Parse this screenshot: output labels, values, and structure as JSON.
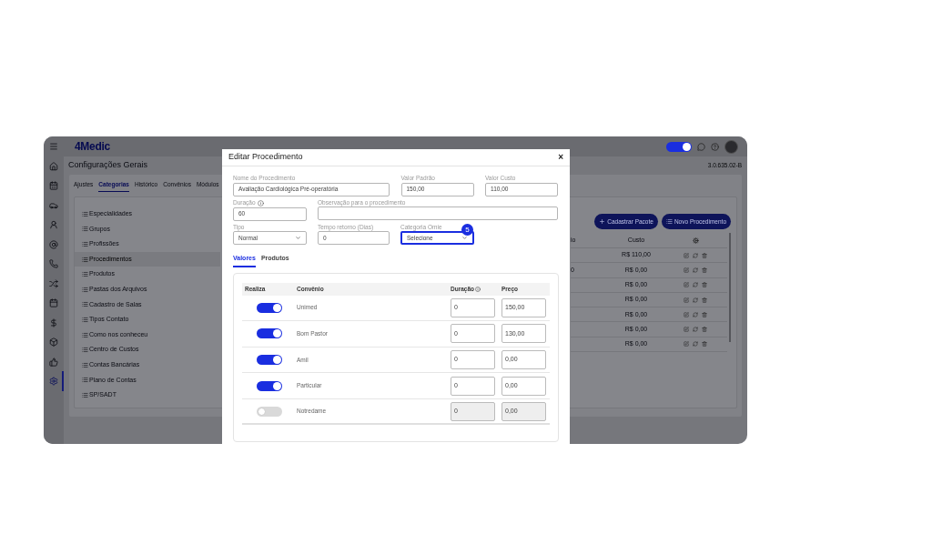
{
  "app": {
    "logo": "4Medic",
    "page_title": "Configurações Gerais",
    "version": "3.0.635.02-B",
    "theme_toggle": {
      "on": true
    }
  },
  "sidebar": {
    "items": [
      {
        "selected": false
      },
      {
        "selected": false
      },
      {
        "selected": false
      },
      {
        "selected": false
      },
      {
        "selected": false
      },
      {
        "selected": false
      },
      {
        "selected": false
      },
      {
        "selected": false
      },
      {
        "selected": false
      },
      {
        "selected": false
      },
      {
        "selected": false
      },
      {
        "selected": true
      }
    ]
  },
  "tabs": [
    {
      "label": "Ajustes",
      "selected": false
    },
    {
      "label": "Categorias",
      "selected": true
    },
    {
      "label": "Histórico",
      "selected": false
    },
    {
      "label": "Convênios",
      "selected": false
    },
    {
      "label": "Módulos",
      "selected": false
    }
  ],
  "categories": [
    {
      "label": "Especialidades",
      "selected": false
    },
    {
      "label": "Grupos",
      "selected": false
    },
    {
      "label": "Profissões",
      "selected": false
    },
    {
      "label": "Procedimentos",
      "selected": true
    },
    {
      "label": "Produtos",
      "selected": false
    },
    {
      "label": "Pastas dos Arquivos",
      "selected": false
    },
    {
      "label": "Cadastro de Salas",
      "selected": false
    },
    {
      "label": "Tipos Contato",
      "selected": false
    },
    {
      "label": "Como nos conheceu",
      "selected": false
    },
    {
      "label": "Centro de Custos",
      "selected": false
    },
    {
      "label": "Contas Bancárias",
      "selected": false
    },
    {
      "label": "Plano de Contas",
      "selected": false
    },
    {
      "label": "SP/SADT",
      "selected": false
    }
  ],
  "buttons": [
    "Cadastrar Pacote",
    "Novo Procedimento"
  ],
  "table": {
    "columns": [
      "io",
      "Custo"
    ],
    "rows": [
      {
        "custo": "R$ 110,00"
      },
      {
        "column_1": "0",
        "custo": "R$ 0,00"
      },
      {
        "custo": "R$ 0,00"
      },
      {
        "custo": "R$ 0,00"
      },
      {
        "custo": "R$ 0,00"
      },
      {
        "custo": "R$ 0,00"
      },
      {
        "custo": "R$ 0,00"
      }
    ]
  },
  "modal": {
    "title": "Editar Procedimento",
    "close": "×",
    "fields": {
      "nome": {
        "label": "Nome do Procedimento",
        "value": "Avaliação Cardiológica Pré-operatória"
      },
      "valor_padrao": {
        "label": "Valor Padrão",
        "value": "150,00"
      },
      "valor_custo": {
        "label": "Valor Custo",
        "value": "110,00"
      },
      "duracao": {
        "label": "Duração",
        "value": "60"
      },
      "observacao": {
        "label": "Observação para o procedimento"
      },
      "tipo": {
        "label": "Tipo",
        "value": "Normal"
      },
      "tempo_retorno": {
        "label": "Tempo retorno (Dias)",
        "value": "0"
      },
      "categoria_omie": {
        "label": "Categoria Omie",
        "value": "Selecione",
        "highlighted": true,
        "step_badge": "5"
      }
    },
    "tabs": [
      {
        "label": "Valores",
        "selected": true
      },
      {
        "label": "Produtos",
        "selected": false
      }
    ],
    "convenios": {
      "columns": [
        "Realiza",
        "Convênio",
        "Duração",
        "Preço"
      ],
      "rows": [
        {
          "on": true,
          "name": "Unimed",
          "duracao": "0",
          "preco": "150,00"
        },
        {
          "on": true,
          "name": "Bom Pastor",
          "duracao": "0",
          "preco": "130,00"
        },
        {
          "on": true,
          "name": "Amil",
          "duracao": "0",
          "preco": "0,00"
        },
        {
          "on": true,
          "name": "Particular",
          "duracao": "0",
          "preco": "0,00"
        },
        {
          "on": false,
          "name": "Notredame",
          "duracao": "0",
          "preco": "0,00"
        }
      ]
    }
  }
}
